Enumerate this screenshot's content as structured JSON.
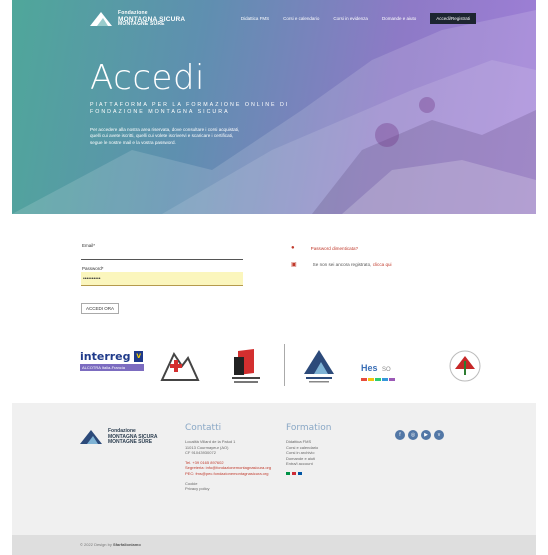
{
  "brand": {
    "line1": "Fondazione",
    "line2": "MONTAGNA SICURA",
    "line3": "MONTAGNE SÛRE"
  },
  "nav": {
    "items": [
      "Didattica FMS",
      "Corsi e calendario",
      "Corsi in evidenza",
      "Domande e aiuto"
    ],
    "login_button": "Accedi/Registrati"
  },
  "hero": {
    "title": "Accedi",
    "subtitle_line1": "PIATTAFORMA PER LA FORMAZIONE ONLINE DI",
    "subtitle_line2": "FONDAZIONE MONTAGNA SICURA",
    "description": "Per accedere alla nostra area riservata, dove consultare i corsi acquistati, quelli cui avete iscritti, quelli cui volete iscrivervi e scaricare i certificati, segue le nostre mail e la vostra password."
  },
  "login": {
    "email_label": "Email*",
    "email_value": "",
    "password_label": "Password*",
    "password_value": "••••••••••",
    "submit_label": "ACCEDI ORA",
    "forgot_text": "Password dimenticata?",
    "register_text": "Se non sei ancora registrato,",
    "register_link": "clicca qui"
  },
  "partners": {
    "interreg": "interreg",
    "interreg_sub": "ALCOTRA",
    "italia_francia": "Italia-Francia",
    "eu_label": "V",
    "hes": "Hes",
    "hes_sub": "SO"
  },
  "footer": {
    "contacts_title": "Contatti",
    "contacts_lines": [
      "Località Villard de la Palud 1",
      "11013 Courmayeur (AO)",
      "CF 91043930072",
      "",
      "Tel. +39 0165 897602",
      "Segreteria: info@fondazionemontagnasicura.org",
      "PEC: fms@pec.fondazionemontagnasicura.org",
      "",
      "Cookie",
      "Privacy policy"
    ],
    "formation_title": "Formation",
    "formation_lines": [
      "Didattica FMS",
      "Corsi e calendario",
      "Corsi in archivio",
      "Domande e aiuti",
      "Entra/i account"
    ],
    "social_icons": [
      "facebook-icon",
      "instagram-icon",
      "youtube-icon",
      "vimeo-icon"
    ],
    "copyright_prefix": "© 2022 Design by",
    "copyright_brand": "Sfarfalloniamo"
  },
  "colors": {
    "hero_start": "#4fa79a",
    "hero_end": "#a07fd8",
    "accent_red": "#c0392b",
    "footer_heading": "#8aa8c6",
    "social_bg": "#5277a6"
  }
}
